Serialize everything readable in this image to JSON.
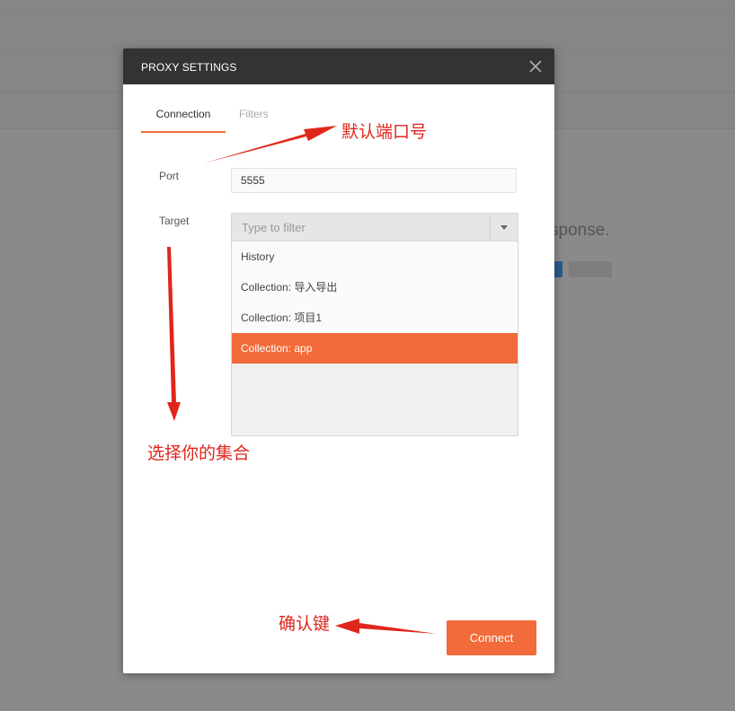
{
  "background": {
    "response_text": "sponse."
  },
  "modal": {
    "title": "PROXY SETTINGS",
    "tabs": [
      {
        "label": "Connection",
        "active": true
      },
      {
        "label": "Filters",
        "active": false
      }
    ],
    "port": {
      "label": "Port",
      "value": "5555"
    },
    "target": {
      "label": "Target",
      "filter_placeholder": "Type to filter",
      "options": [
        {
          "label": "History",
          "selected": false
        },
        {
          "label": "Collection: 导入导出",
          "selected": false
        },
        {
          "label": "Collection: 项目1",
          "selected": false
        },
        {
          "label": "Collection: app",
          "selected": true
        }
      ]
    },
    "connect_label": "Connect"
  },
  "annotations": {
    "port_note": "默认端口号",
    "target_note": "选择你的集合",
    "confirm_note": "确认键"
  },
  "colors": {
    "accent": "#f26b3a",
    "header": "#333333",
    "annotation": "#e0261b"
  },
  "icons": {
    "close": "close-icon",
    "dropdown": "chevron-down-icon"
  }
}
